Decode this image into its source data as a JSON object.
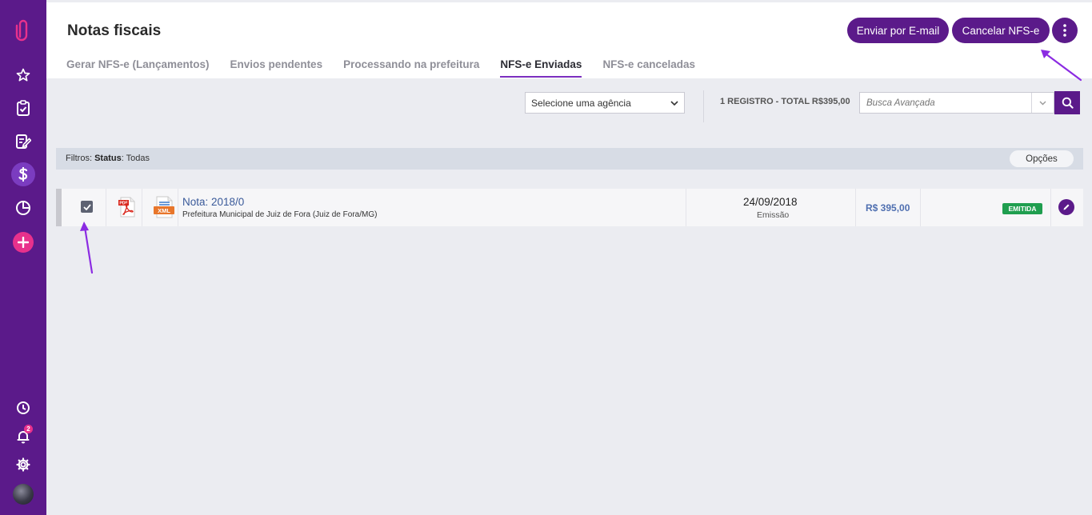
{
  "sidebar": {
    "icons": [
      "paperclip-icon",
      "star-icon",
      "clipboard-check-icon",
      "edit-note-icon",
      "dollar-icon",
      "pie-chart-icon",
      "plus-icon",
      "clock-icon",
      "bell-icon",
      "gear-icon",
      "avatar"
    ],
    "notification_count": "2",
    "accent": "#5b1a8a",
    "plus_color": "#e8318c"
  },
  "header": {
    "title": "Notas fiscais",
    "tabs": [
      {
        "label": "Gerar NFS-e (Lançamentos)"
      },
      {
        "label": "Envios pendentes"
      },
      {
        "label": "Processando na prefeitura"
      },
      {
        "label": "NFS-e Enviadas",
        "active": true
      },
      {
        "label": "NFS-e canceladas"
      }
    ],
    "email_button": "Enviar por E-mail",
    "cancel_button": "Cancelar NFS-e"
  },
  "toolbar": {
    "agency_placeholder": "Selecione uma agência",
    "records": "1 REGISTRO - TOTAL R$395,00",
    "search_placeholder": "Busca Avançada"
  },
  "filters": {
    "prefix": "Filtros:",
    "status_label": "Status",
    "status_value": ": Todas",
    "options_button": "Opções"
  },
  "rows": [
    {
      "checked": true,
      "pdf_label": "PDF",
      "xml_label": "XML",
      "title": "Nota: 2018/0",
      "subtitle": "Prefeitura Municipal de Juiz de Fora (Juiz de Fora/MG)",
      "date": "24/09/2018",
      "date_label": "Emissão",
      "amount": "R$ 395,00",
      "status": "EMITIDA",
      "status_color": "#1f9e4f"
    }
  ]
}
